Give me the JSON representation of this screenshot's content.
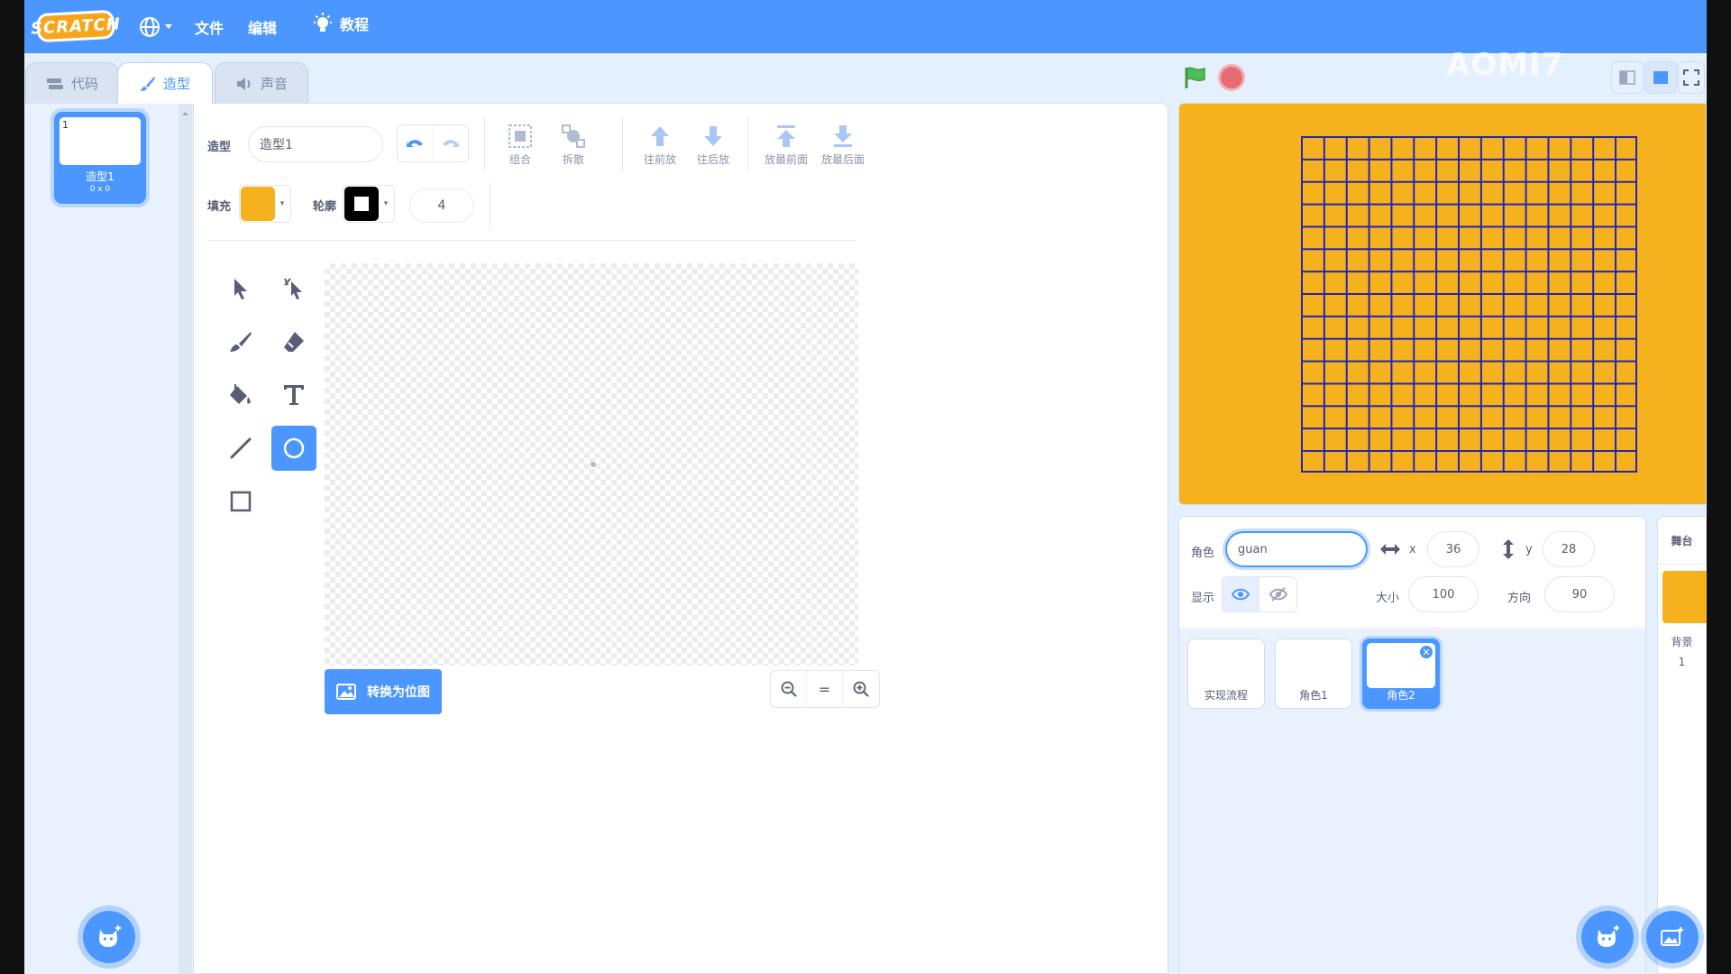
{
  "menu": {
    "logo": "SCRATCH",
    "file": "文件",
    "edit": "编辑",
    "tutorials": "教程"
  },
  "watermark": "AOMI7",
  "tabs": [
    {
      "label": "代码",
      "icon": "code-icon"
    },
    {
      "label": "造型",
      "icon": "brush-icon",
      "active": true
    },
    {
      "label": "声音",
      "icon": "speaker-icon"
    }
  ],
  "costume_list": {
    "items": [
      {
        "number": "1",
        "name": "造型1",
        "size": "0 x 0"
      }
    ]
  },
  "editor": {
    "costume_label": "造型",
    "costume_name": "造型1",
    "group": "组合",
    "ungroup": "拆散",
    "forward": "往前放",
    "backward": "往后放",
    "front": "放最前面",
    "back": "放最后面",
    "fill_label": "填充",
    "fill_color": "#f6b21d",
    "outline_label": "轮廓",
    "outline_color": "#000000",
    "outline_width": "4",
    "convert_bitmap": "转换为位图",
    "zoom_reset": "="
  },
  "stage": {
    "background_color": "#f6b21d",
    "grid_color": "#2323b8",
    "grid_cells": 15
  },
  "sprite_info": {
    "sprite_label": "角色",
    "sprite_name": "guan",
    "x_label": "x",
    "x_value": "36",
    "y_label": "y",
    "y_value": "28",
    "show_label": "显示",
    "size_label": "大小",
    "size_value": "100",
    "direction_label": "方向",
    "direction_value": "90"
  },
  "sprites": [
    {
      "name": "实现流程"
    },
    {
      "name": "角色1"
    },
    {
      "name": "角色2",
      "selected": true
    }
  ],
  "stage_pane": {
    "title": "舞台",
    "backdrop_label": "背景",
    "backdrop_count": "1"
  },
  "colors": {
    "accent": "#4c97ff",
    "menubar": "#4c97ff",
    "stop": "#e86b73",
    "flag": "#4cbf56"
  }
}
